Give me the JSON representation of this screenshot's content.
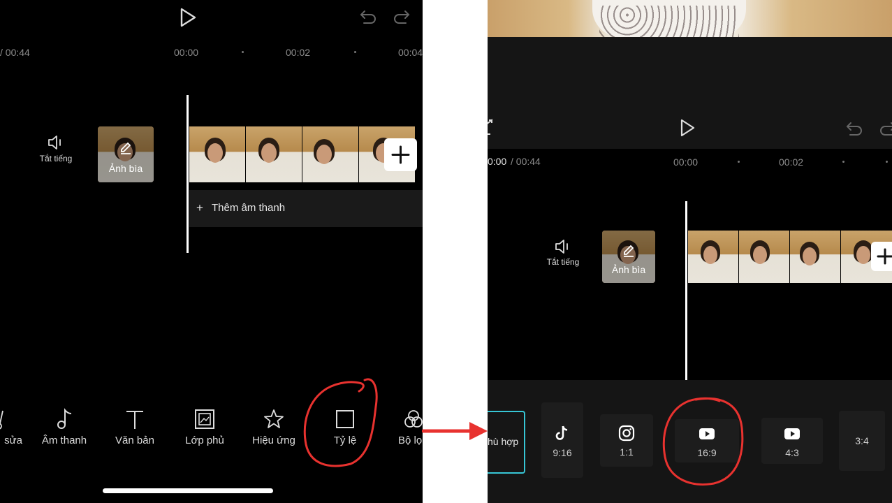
{
  "left": {
    "time": {
      "current_total": "/ 00:44",
      "ticks": [
        "00:00",
        "00:02",
        "00:04"
      ]
    },
    "mute_label": "Tắt tiếng",
    "cover_label": "Ảnh bìa",
    "add_audio_label": "Thêm âm thanh",
    "toolbar": [
      {
        "label": "sửa",
        "icon": "scissors-icon"
      },
      {
        "label": "Âm thanh",
        "icon": "music-note-icon"
      },
      {
        "label": "Văn bản",
        "icon": "text-icon"
      },
      {
        "label": "Lớp phủ",
        "icon": "overlay-icon"
      },
      {
        "label": "Hiệu ứng",
        "icon": "effects-star-icon"
      },
      {
        "label": "Tỷ lệ",
        "icon": "ratio-square-icon"
      },
      {
        "label": "Bộ lọ",
        "icon": "filter-icon"
      }
    ]
  },
  "right": {
    "time": {
      "current": "0:00",
      "total": "/ 00:44",
      "ticks": [
        "00:00",
        "00:02"
      ]
    },
    "mute_label": "Tắt tiếng",
    "cover_label": "Ảnh bìa",
    "ratios": [
      {
        "label": "hù hợp",
        "icon": ""
      },
      {
        "label": "9:16",
        "icon": "tiktok-icon"
      },
      {
        "label": "1:1",
        "icon": "instagram-icon"
      },
      {
        "label": "16:9",
        "icon": "youtube-icon"
      },
      {
        "label": "4:3",
        "icon": "youtube-icon"
      },
      {
        "label": "3:4",
        "icon": ""
      }
    ]
  },
  "colors": {
    "highlight": "#e8322f",
    "selected_border": "#37c6d6",
    "arrow": "#e8322f"
  }
}
